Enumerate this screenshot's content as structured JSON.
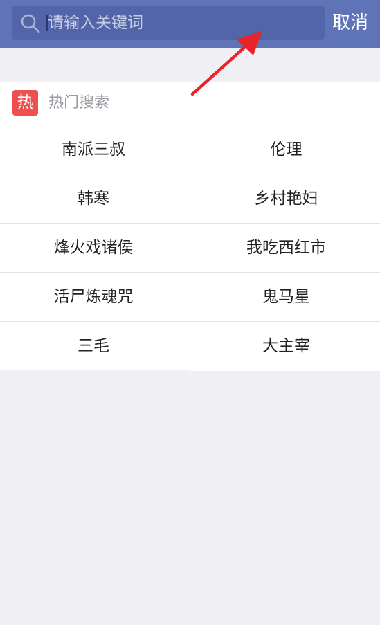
{
  "search": {
    "placeholder": "请输入关键词",
    "value": "",
    "cancel_label": "取消"
  },
  "hot": {
    "badge": "热",
    "title": "热门搜索",
    "items": [
      [
        "南派三叔",
        "伦理"
      ],
      [
        "韩寒",
        "乡村艳妇"
      ],
      [
        "烽火戏诸侯",
        "我吃西红市"
      ],
      [
        "活尸炼魂咒",
        "鬼马星"
      ],
      [
        "三毛",
        "大主宰"
      ]
    ]
  },
  "colors": {
    "header": "#5f73b7",
    "search_box": "#5265a8",
    "badge": "#ee4f4f",
    "annotation_arrow": "#e8232a"
  },
  "icons": {
    "search": "search-icon",
    "annotation": "red-arrow-icon"
  }
}
